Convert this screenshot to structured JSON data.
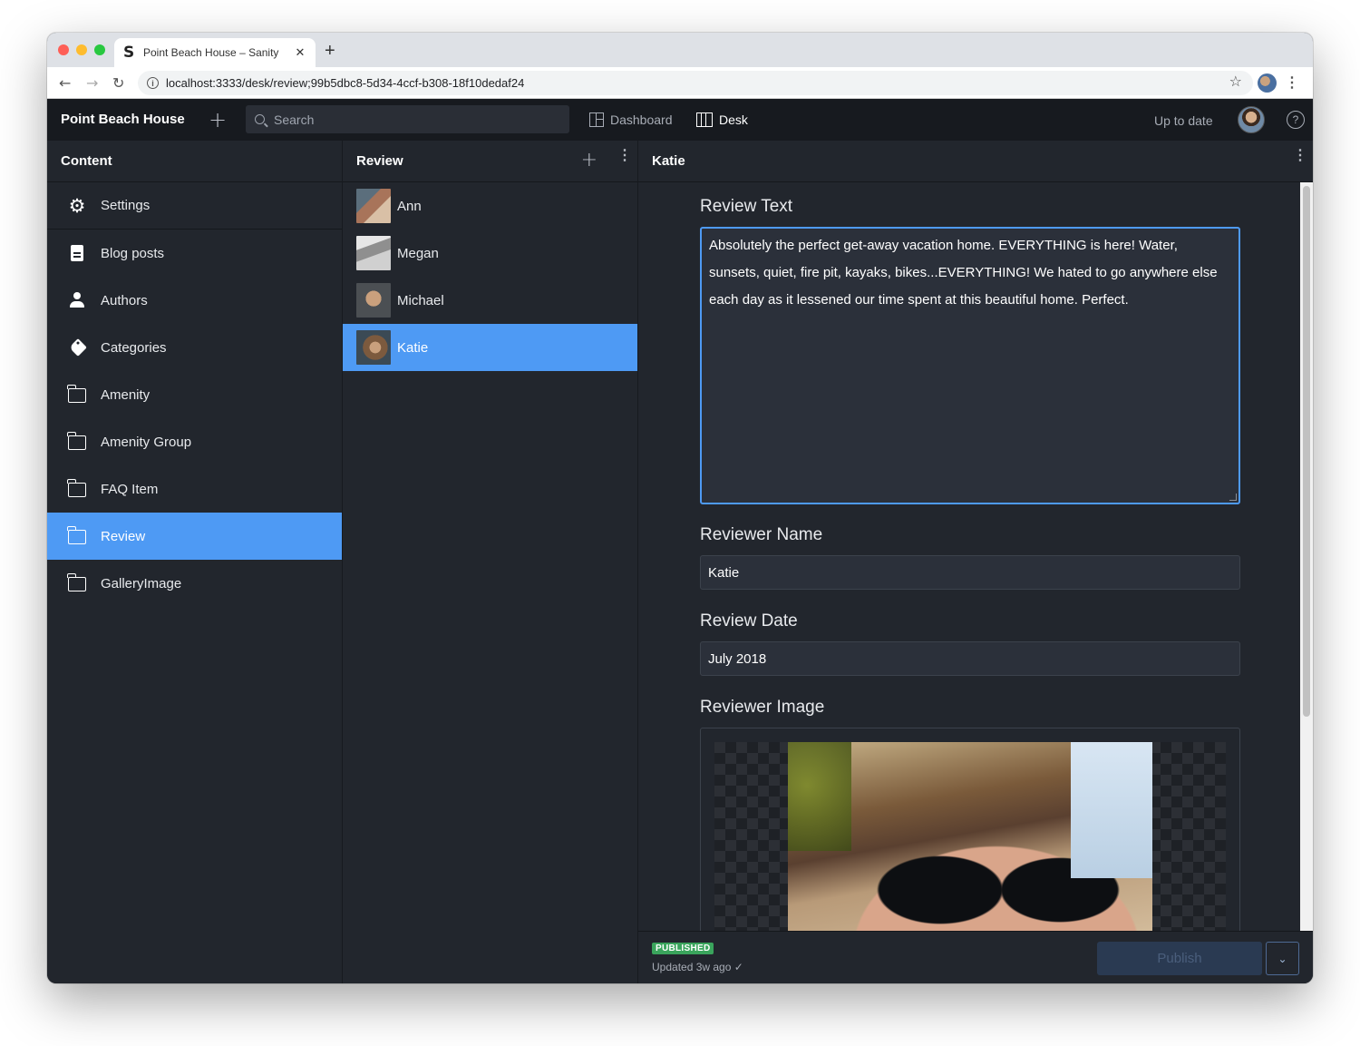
{
  "browser": {
    "tab_title": "Point Beach House – Sanity",
    "tab_favicon": "S",
    "url": "localhost:3333/desk/review;99b5dbc8-5d34-4ccf-b308-18f10dedaf24"
  },
  "navbar": {
    "brand": "Point Beach House",
    "search_placeholder": "Search",
    "tools": [
      {
        "label": "Dashboard",
        "icon": "grid-icon"
      },
      {
        "label": "Desk",
        "icon": "columns-icon"
      }
    ],
    "status": "Up to date"
  },
  "content_pane": {
    "title": "Content",
    "items": [
      {
        "label": "Settings",
        "icon": "gear-icon"
      },
      {
        "label": "Blog posts",
        "icon": "document-icon"
      },
      {
        "label": "Authors",
        "icon": "user-icon"
      },
      {
        "label": "Categories",
        "icon": "tag-icon"
      },
      {
        "label": "Amenity",
        "icon": "folder-icon"
      },
      {
        "label": "Amenity Group",
        "icon": "folder-icon"
      },
      {
        "label": "FAQ Item",
        "icon": "folder-icon"
      },
      {
        "label": "Review",
        "icon": "folder-icon",
        "active": true
      },
      {
        "label": "GalleryImage",
        "icon": "folder-icon"
      }
    ]
  },
  "review_pane": {
    "title": "Review",
    "items": [
      {
        "label": "Ann"
      },
      {
        "label": "Megan"
      },
      {
        "label": "Michael"
      },
      {
        "label": "Katie",
        "active": true
      }
    ]
  },
  "editor": {
    "title": "Katie",
    "fields": {
      "review_text_label": "Review Text",
      "review_text_value": "Absolutely the perfect get-away vacation home. EVERYTHING is here! Water, sunsets, quiet, fire pit, kayaks, bikes...EVERYTHING! We hated to go anywhere else each day as it lessened our time spent at this beautiful home. Perfect.",
      "reviewer_name_label": "Reviewer Name",
      "reviewer_name_value": "Katie",
      "review_date_label": "Review Date",
      "review_date_value": "July 2018",
      "reviewer_image_label": "Reviewer Image"
    },
    "footer": {
      "badge": "PUBLISHED",
      "updated": "Updated 3w ago ✓",
      "publish_label": "Publish"
    }
  },
  "colors": {
    "accent": "#4e9af4",
    "navbar_bg": "#171a1f",
    "pane_bg": "#22262d",
    "published_badge": "#3aa45c"
  }
}
